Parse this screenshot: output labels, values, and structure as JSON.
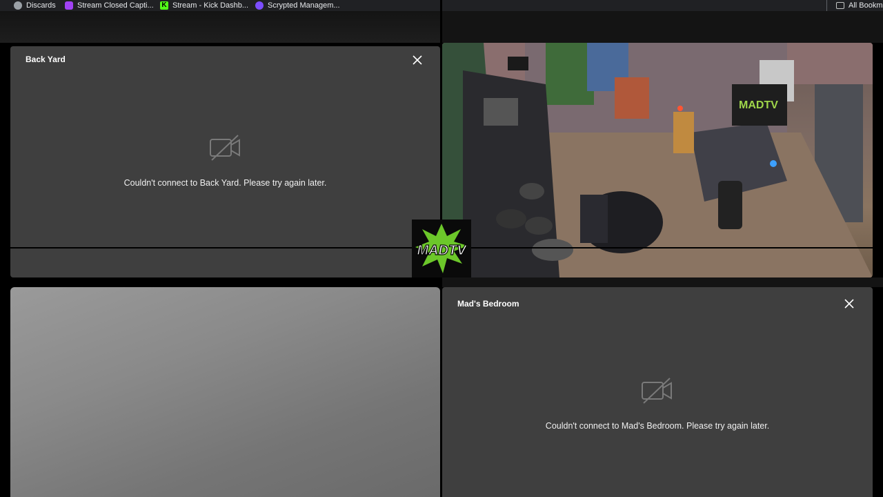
{
  "bookmarks": {
    "items": [
      {
        "label": "Discards",
        "icon": "discard-icon"
      },
      {
        "label": "Stream Closed Capti...",
        "icon": "closed-captions-icon"
      },
      {
        "label": "Stream - Kick Dashb...",
        "icon": "kick-icon"
      },
      {
        "label": "Scrypted Managem...",
        "icon": "scrypted-icon"
      }
    ],
    "all_bookmarks": "All Bookm"
  },
  "panels": {
    "back_yard": {
      "title": "Back Yard",
      "error": "Couldn't connect to Back Yard. Please try again later."
    },
    "bedroom": {
      "title": "Mad's Bedroom",
      "error": "Couldn't connect to Mad's Bedroom. Please try again later."
    }
  },
  "logo": {
    "text": "MADTV"
  },
  "colors": {
    "panel": "#3f3f3f",
    "accent": "#7ed321"
  }
}
